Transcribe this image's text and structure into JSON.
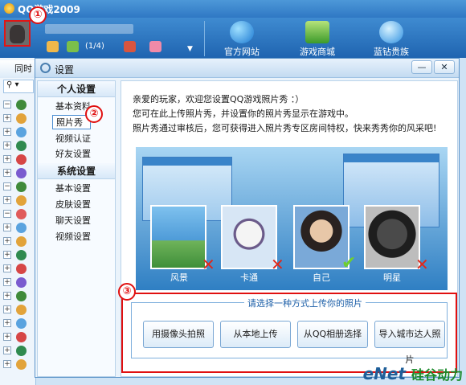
{
  "app": {
    "title": "QQ游戏2009"
  },
  "markers": [
    "①",
    "②",
    "③"
  ],
  "topbar": {
    "user_count": "(1/4)",
    "nav": [
      {
        "label": "官方网站",
        "icon": "globe-icon"
      },
      {
        "label": "游戏商城",
        "icon": "shop-icon"
      },
      {
        "label": "蓝钻贵族",
        "icon": "diamond-icon"
      }
    ]
  },
  "left_panel": {
    "tab_label": "同时"
  },
  "dialog": {
    "title": "设置",
    "min_label": "—",
    "close_label": "✕",
    "menu": {
      "header_personal": "个人设置",
      "personal_items": [
        "基本资料",
        "照片秀",
        "视频认证",
        "好友设置"
      ],
      "header_system": "系统设置",
      "system_items": [
        "基本设置",
        "皮肤设置",
        "聊天设置",
        "视频设置"
      ]
    },
    "content": {
      "line1": "亲爱的玩家，欢迎您设置QQ游戏照片秀 ：）",
      "line2": "您可在此上传照片秀，并设置你的照片秀显示在游戏中。",
      "line3": "照片秀通过审核后，您可获得进入照片秀专区房间特权，快来秀秀你的风采吧!",
      "samples": [
        {
          "label": "风景",
          "mark": "✕",
          "ok": false
        },
        {
          "label": "卡通",
          "mark": "✕",
          "ok": false
        },
        {
          "label": "自己",
          "mark": "✔",
          "ok": true
        },
        {
          "label": "明星",
          "mark": "✕",
          "ok": false
        }
      ],
      "upload_title": "请选择一种方式上传你的照片",
      "buttons": [
        "用摄像头拍照",
        "从本地上传",
        "从QQ相册选择",
        "导入城市达人照片"
      ]
    }
  },
  "watermark": {
    "text": "eNet",
    "sub": "硅谷动力"
  },
  "colors": {
    "accent": "#2f78c4",
    "marker": "#e01010",
    "ok": "#6fce2f",
    "no": "#e0281a"
  }
}
